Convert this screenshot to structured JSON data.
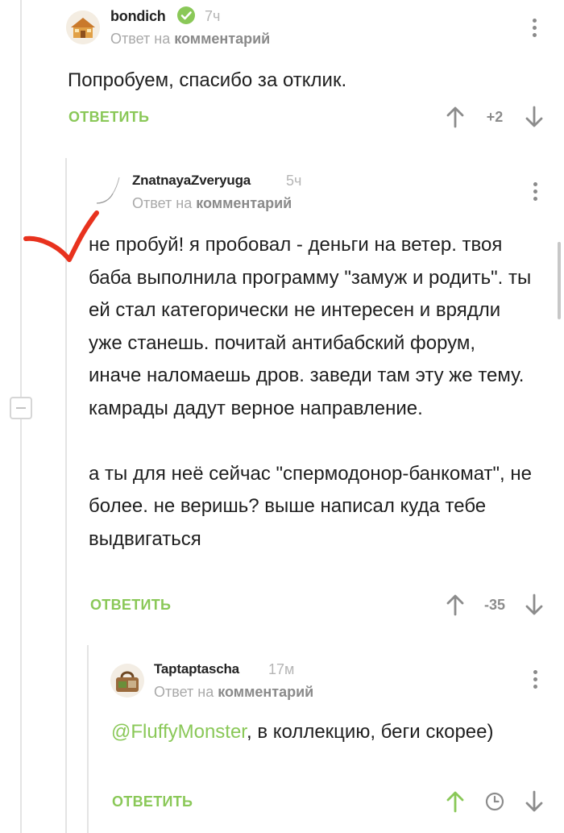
{
  "colors": {
    "accent": "#8ac858",
    "upvote_active": "#8ac858",
    "muted": "#a9a9a9",
    "mark_red": "#e8321e"
  },
  "comments": [
    {
      "username": "bondich",
      "verified": true,
      "time": "7ч",
      "reply_prefix": "Ответ на",
      "reply_link": "комментарий",
      "body": [
        "Попробуем, спасибо за отклик."
      ],
      "reply_label": "ОТВЕТИТЬ",
      "rating": "+2",
      "avatar_icon": "house-avatar"
    },
    {
      "username": "ZnatnayaZveryuga",
      "time": "5ч",
      "reply_prefix": "Ответ на",
      "reply_link": "комментарий",
      "body": [
        "не пробуй! я пробовал - деньги на ветер. твоя баба выполнила программу \"замуж и родить\". ты ей стал категорически не интересен и врядли уже станешь. почитай антибабский форум, иначе наломаешь дров. заведи там эту же тему. камрады дадут верное направление.",
        "а ты для неё сейчас \"спермодонор-банкомат\", не более. не веришь? выше написал куда тебе выдвигаться"
      ],
      "reply_label": "ОТВЕТИТЬ",
      "rating": "-35",
      "avatar_icon": "sketch-avatar"
    },
    {
      "username": "Taptaptascha",
      "time": "17м",
      "reply_prefix": "Ответ на",
      "reply_link": "комментарий",
      "mention": "@FluffyMonster",
      "body_after_mention": ", в коллекцию, беги скорее)",
      "reply_label": "ОТВЕТИТЬ",
      "avatar_icon": "bag-avatar",
      "upvoted": true
    }
  ]
}
